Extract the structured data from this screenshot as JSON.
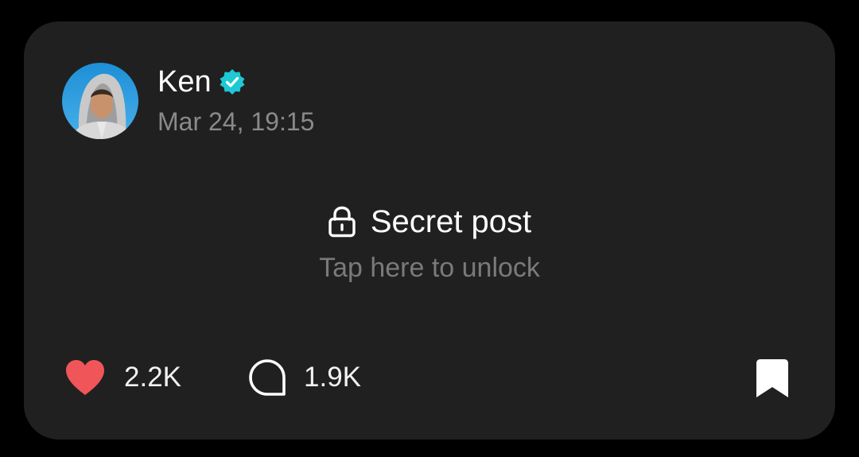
{
  "post": {
    "author": {
      "name": "Ken",
      "verified": true,
      "avatar_icon": "avatar-hooded-person"
    },
    "timestamp": "Mar 24, 19:15",
    "secret": {
      "title": "Secret post",
      "hint": "Tap here to unlock",
      "icon": "lock-icon"
    },
    "actions": {
      "likes": {
        "count": "2.2K",
        "icon": "heart-icon",
        "color": "#f0555a"
      },
      "comments": {
        "count": "1.9K",
        "icon": "comment-bubble-icon"
      },
      "bookmark": {
        "icon": "bookmark-icon"
      }
    }
  },
  "colors": {
    "background": "#000000",
    "card": "#202020",
    "verified_badge": "#1ec8d4",
    "secondary_text": "#8a8a8a"
  }
}
